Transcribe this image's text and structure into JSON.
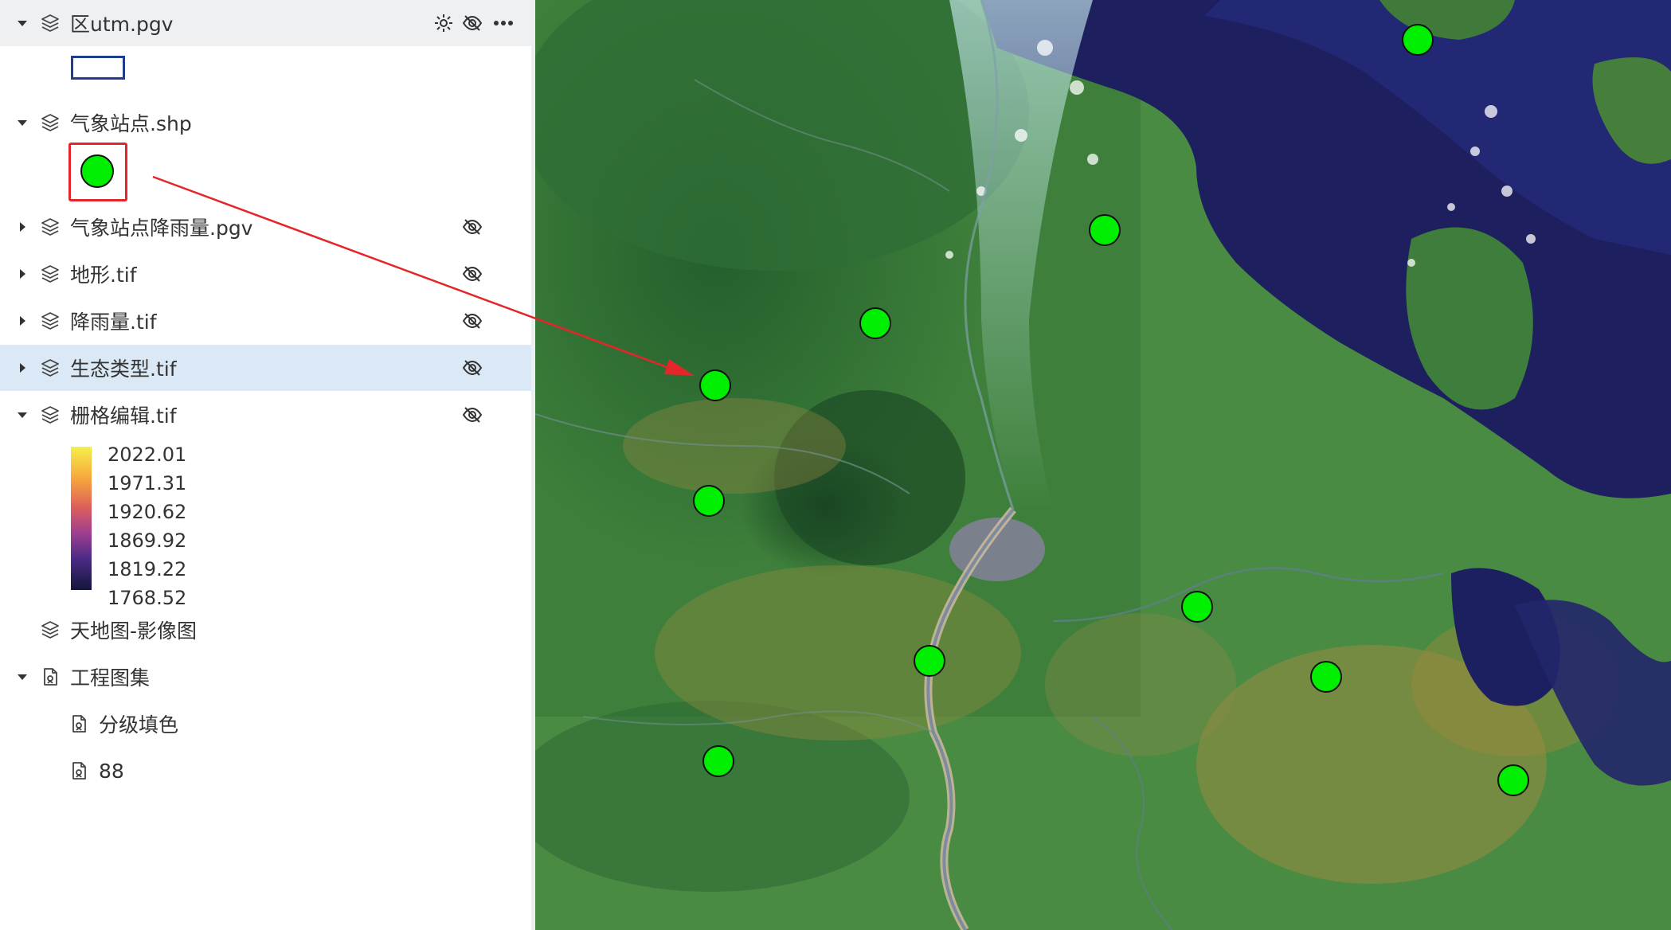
{
  "layers": [
    {
      "label": "区utm.pgv",
      "icon": "layers-icon",
      "expanded": true
    },
    {
      "label": "气象站点.shp",
      "icon": "layers-icon",
      "expanded": true
    },
    {
      "label": "气象站点降雨量.pgv",
      "icon": "layers-icon",
      "expanded": false,
      "visible": false
    },
    {
      "label": "地形.tif",
      "icon": "layers-icon",
      "expanded": false,
      "visible": false
    },
    {
      "label": "降雨量.tif",
      "icon": "layers-icon",
      "expanded": false,
      "visible": false
    },
    {
      "label": "生态类型.tif",
      "icon": "layers-icon",
      "expanded": false,
      "visible": false,
      "selected": true
    },
    {
      "label": "栅格编辑.tif",
      "icon": "layers-icon",
      "expanded": true,
      "visible": false
    },
    {
      "label": "天地图-影像图",
      "icon": "layers-icon"
    },
    {
      "label": "工程图集",
      "icon": "document-icon",
      "expanded": true
    }
  ],
  "raster_legend": {
    "values": [
      "2022.01",
      "1971.31",
      "1920.62",
      "1869.92",
      "1819.22",
      "1768.52"
    ]
  },
  "atlas_items": [
    "分级填色",
    "88"
  ],
  "station_symbol_color": "#00ee00",
  "legend_box_color": "#1f3f8c",
  "annotation_color": "#e4262a"
}
